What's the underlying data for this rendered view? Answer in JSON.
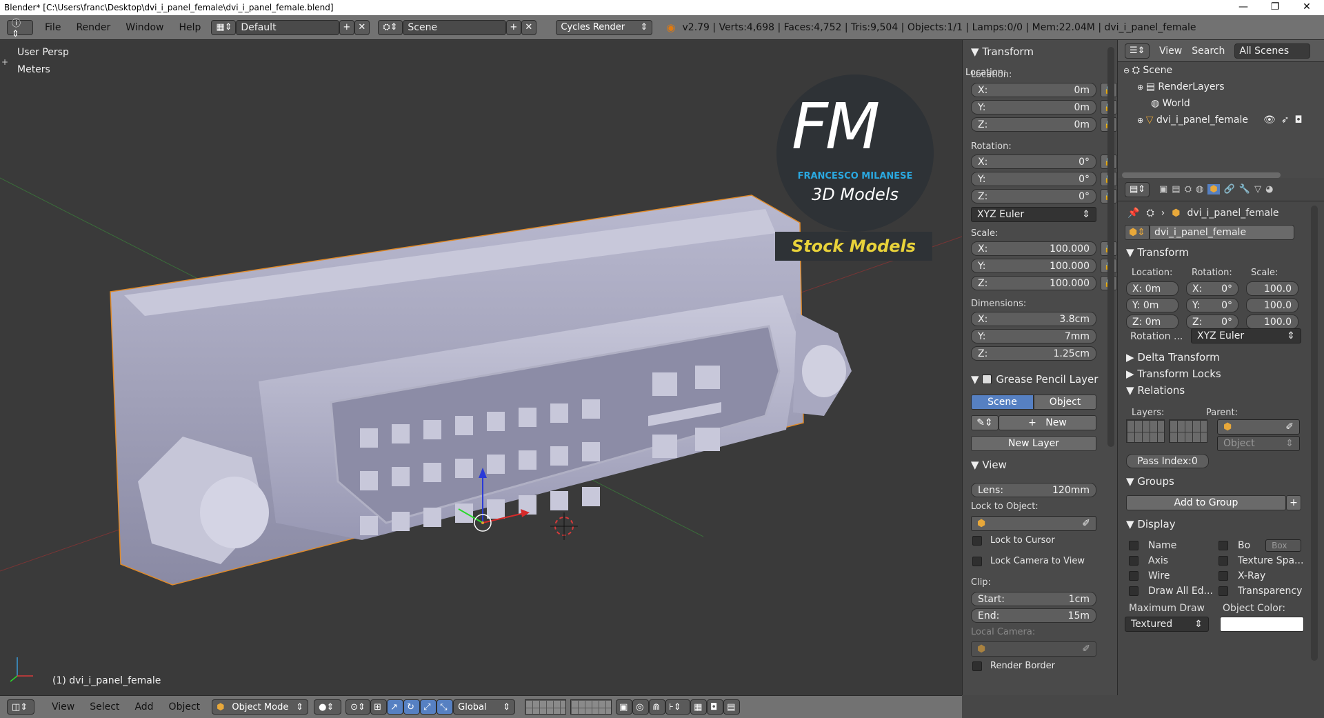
{
  "titlebar": {
    "text": "Blender* [C:\\Users\\franc\\Desktop\\dvi_i_panel_female\\dvi_i_panel_female.blend]"
  },
  "info": {
    "menus": [
      "File",
      "Render",
      "Window",
      "Help"
    ],
    "layout": "Default",
    "scene": "Scene",
    "engine": "Cycles Render",
    "stats": "v2.79 | Verts:4,698 | Faces:4,752 | Tris:9,504 | Objects:1/1 | Lamps:0/0 | Mem:22.04M | dvi_i_panel_female"
  },
  "viewport": {
    "view_name": "User Persp",
    "units": "Meters",
    "object_label": "(1) dvi_i_panel_female",
    "logo_letters": "FM",
    "logo_name": "FRANCESCO MILANESE",
    "logo_sub": "3D Models",
    "logo_banner": "Stock Models"
  },
  "npanel": {
    "transform_title": "Transform",
    "location_label": "Location:",
    "location": [
      {
        "axis": "X:",
        "value": "0m"
      },
      {
        "axis": "Y:",
        "value": "0m"
      },
      {
        "axis": "Z:",
        "value": "0m"
      }
    ],
    "rotation_label": "Rotation:",
    "rotation": [
      {
        "axis": "X:",
        "value": "0°"
      },
      {
        "axis": "Y:",
        "value": "0°"
      },
      {
        "axis": "Z:",
        "value": "0°"
      }
    ],
    "rotation_mode": "XYZ Euler",
    "scale_label": "Scale:",
    "scale": [
      {
        "axis": "X:",
        "value": "100.000"
      },
      {
        "axis": "Y:",
        "value": "100.000"
      },
      {
        "axis": "Z:",
        "value": "100.000"
      }
    ],
    "dimensions_label": "Dimensions:",
    "dimensions": [
      {
        "axis": "X:",
        "value": "3.8cm"
      },
      {
        "axis": "Y:",
        "value": "7mm"
      },
      {
        "axis": "Z:",
        "value": "1.25cm"
      }
    ],
    "gp_title": "Grease Pencil Layer",
    "gp_scene": "Scene",
    "gp_object": "Object",
    "gp_new": "New",
    "gp_new_layer": "New Layer",
    "view_title": "View",
    "lens_label": "Lens:",
    "lens_value": "120mm",
    "lock_object_label": "Lock to Object:",
    "lock_cursor": "Lock to Cursor",
    "lock_camera": "Lock Camera to View",
    "clip_label": "Clip:",
    "clip_start_label": "Start:",
    "clip_start": "1cm",
    "clip_end_label": "End:",
    "clip_end": "15m",
    "local_camera": "Local Camera:",
    "render_border": "Render Border"
  },
  "outliner": {
    "view": "View",
    "search": "Search",
    "filter": "All Scenes",
    "items": [
      "Scene",
      "RenderLayers",
      "World",
      "dvi_i_panel_female"
    ]
  },
  "props": {
    "object_name": "dvi_i_panel_female",
    "name_field": "dvi_i_panel_female",
    "transform": "Transform",
    "location_label": "Location:",
    "rotation_label": "Rotation:",
    "scale_label": "Scale:",
    "loc": [
      "X: 0m",
      "Y: 0m",
      "Z: 0m"
    ],
    "rot": [
      "X:",
      "Y:",
      "Z:"
    ],
    "rot_vals": [
      "0°",
      "0°",
      "0°"
    ],
    "scl": [
      "100.0",
      "100.0",
      "100.0"
    ],
    "rotation_mode_label": "Rotation ...",
    "rotation_mode": "XYZ Euler",
    "delta": "Delta Transform",
    "locks": "Transform Locks",
    "relations": "Relations",
    "layers_label": "Layers:",
    "parent_label": "Parent:",
    "parent_type": "Object",
    "pass_index": "Pass Index:0",
    "groups": "Groups",
    "add_to_group": "Add to Group",
    "display": "Display",
    "display_left": [
      "Name",
      "Axis",
      "Wire",
      "Draw All Ed..."
    ],
    "display_right": [
      "Bo",
      "Texture Spa...",
      "X-Ray",
      "Transparency"
    ],
    "bounds_type": "Box",
    "max_draw_label": "Maximum Draw",
    "max_draw": "Textured",
    "object_color_label": "Object Color:"
  },
  "bottom": {
    "menus": [
      "View",
      "Select",
      "Add",
      "Object"
    ],
    "mode": "Object Mode",
    "orientation": "Global"
  }
}
